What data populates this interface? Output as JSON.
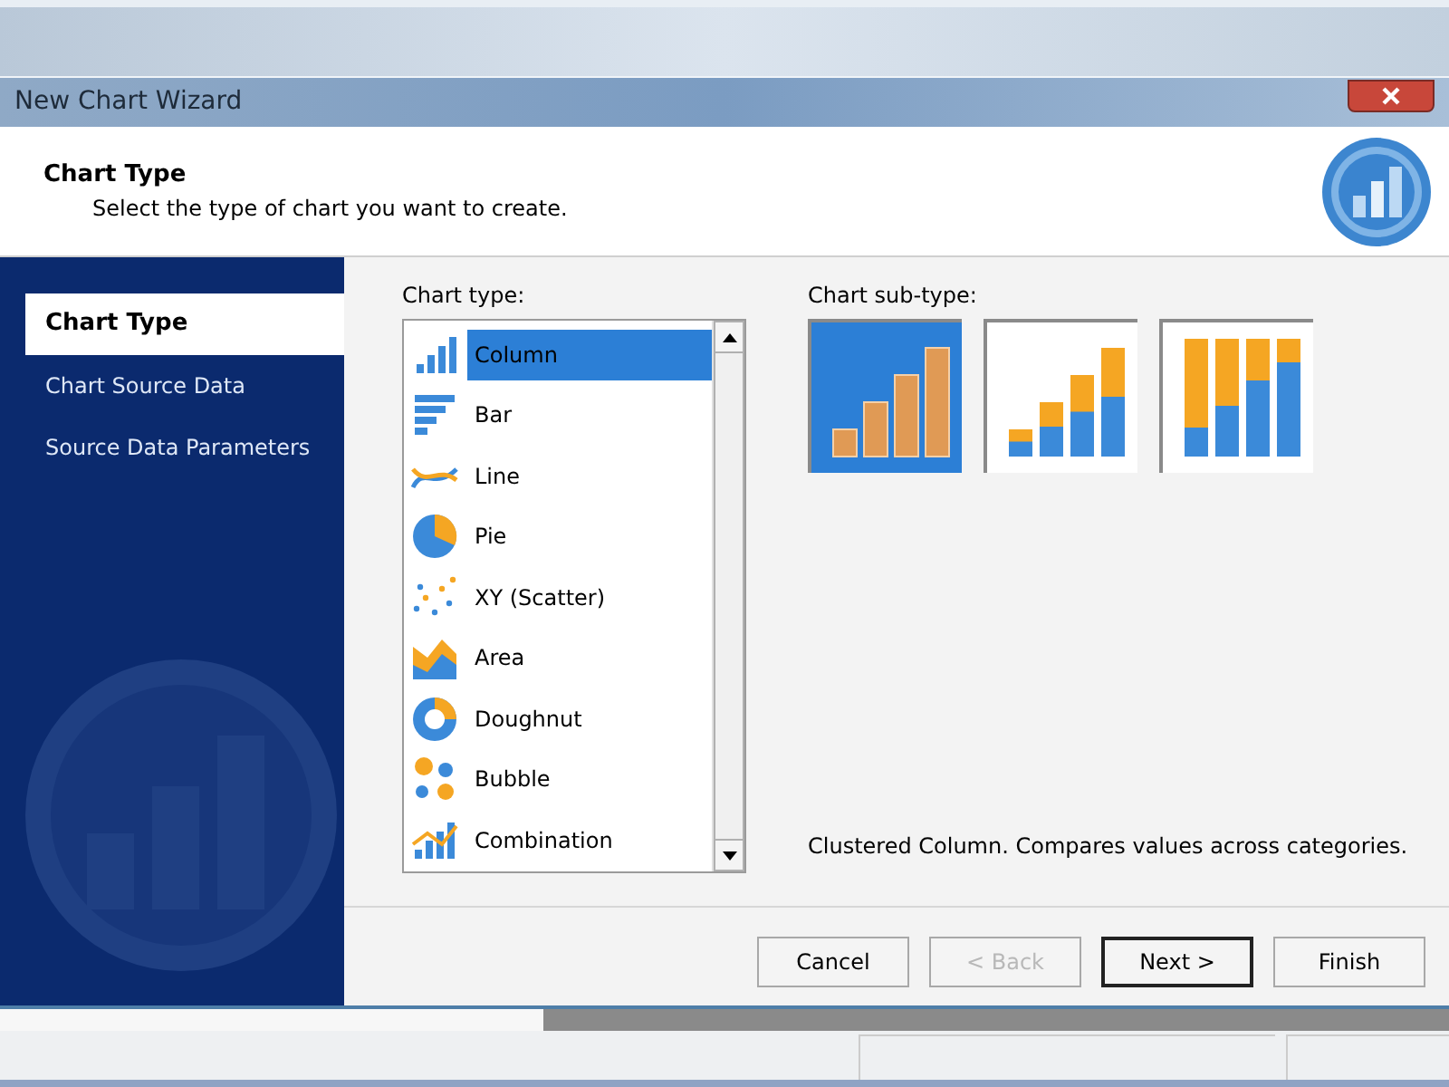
{
  "window": {
    "title": "New Chart Wizard"
  },
  "header": {
    "title": "Chart Type",
    "subtitle": "Select the type of chart you want to create."
  },
  "steps": [
    {
      "label": "Chart Type",
      "selected": true
    },
    {
      "label": "Chart Source Data",
      "selected": false
    },
    {
      "label": "Source Data Parameters",
      "selected": false
    }
  ],
  "chart_type": {
    "label": "Chart type:",
    "items": [
      {
        "label": "Column",
        "kind": "column",
        "selected": true
      },
      {
        "label": "Bar",
        "kind": "bar",
        "selected": false
      },
      {
        "label": "Line",
        "kind": "line",
        "selected": false
      },
      {
        "label": "Pie",
        "kind": "pie",
        "selected": false
      },
      {
        "label": "XY (Scatter)",
        "kind": "scatter",
        "selected": false
      },
      {
        "label": "Area",
        "kind": "area",
        "selected": false
      },
      {
        "label": "Doughnut",
        "kind": "doughnut",
        "selected": false
      },
      {
        "label": "Bubble",
        "kind": "bubble",
        "selected": false
      },
      {
        "label": "Combination",
        "kind": "combination",
        "selected": false
      }
    ]
  },
  "chart_subtype": {
    "label": "Chart sub-type:",
    "items": [
      {
        "kind": "clustered",
        "selected": true
      },
      {
        "kind": "stacked",
        "selected": false
      },
      {
        "kind": "stacked100",
        "selected": false
      }
    ],
    "description": "Clustered Column. Compares values across categories."
  },
  "buttons": [
    {
      "label": "Cancel",
      "disabled": false,
      "default": false
    },
    {
      "label": "< Back",
      "disabled": true,
      "default": false
    },
    {
      "label": "Next >",
      "disabled": false,
      "default": true
    },
    {
      "label": "Finish",
      "disabled": false,
      "default": false
    }
  ]
}
